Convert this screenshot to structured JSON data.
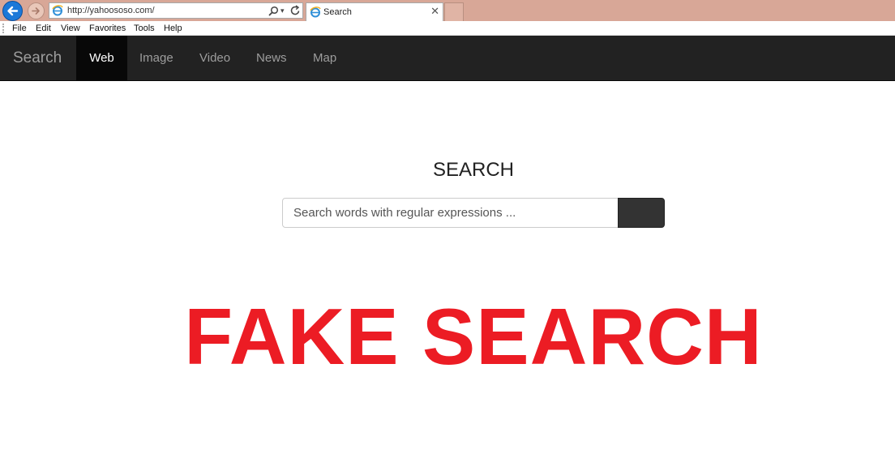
{
  "browser": {
    "address_bar": {
      "url": "http://yahoososo.com/"
    },
    "tab": {
      "title": "Search",
      "close_glyph": "✕"
    },
    "menu": [
      "File",
      "Edit",
      "View",
      "Favorites",
      "Tools",
      "Help"
    ],
    "icons": {
      "back": "back-arrow-icon",
      "forward": "forward-arrow-icon",
      "site": "ie-logo-icon",
      "search": "search-icon",
      "dropdown": "chevron-down-icon",
      "refresh": "refresh-icon"
    },
    "colors": {
      "frame": "#d8a797",
      "back_button": "#1b78d8"
    }
  },
  "site": {
    "brand": "Search",
    "nav": [
      {
        "label": "Web",
        "active": true
      },
      {
        "label": "Image",
        "active": false
      },
      {
        "label": "Video",
        "active": false
      },
      {
        "label": "News",
        "active": false
      },
      {
        "label": "Map",
        "active": false
      }
    ],
    "heading": "SEARCH",
    "search": {
      "placeholder": "Search words with regular expressions ...",
      "value": ""
    },
    "colors": {
      "navbar": "#222222",
      "nav_active": "#080808",
      "search_button": "#333333"
    }
  },
  "overlay": {
    "text": "FAKE SEARCH",
    "color": "#ec1c24"
  }
}
